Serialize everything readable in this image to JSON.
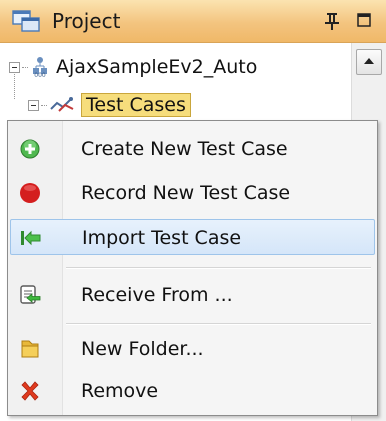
{
  "panel": {
    "title": "Project",
    "icons": {
      "project": "project-tree-icon",
      "pin": "pin-icon",
      "maximize": "maximize-icon"
    }
  },
  "tree": {
    "root_label": "AjaxSampleEv2_Auto",
    "child_label": "Test Cases",
    "icons": {
      "root": "project-node-icon",
      "child": "test-cases-icon"
    }
  },
  "context_menu": {
    "items": [
      {
        "label": "Create New Test Case",
        "icon": "green-plus-icon"
      },
      {
        "label": "Record New Test Case",
        "icon": "red-record-icon"
      },
      {
        "label": "Import Test Case",
        "icon": "import-arrow-icon",
        "highlighted": true
      },
      {
        "label": "Receive From ...",
        "icon": "receive-icon"
      },
      {
        "label": "New Folder...",
        "icon": "folder-icon"
      },
      {
        "label": "Remove",
        "icon": "red-x-icon"
      }
    ]
  },
  "colors": {
    "header": "#f3c47f",
    "selection": "#f6dd7c",
    "menu_highlight": "#d5e6f9",
    "record_red": "#d41e1e",
    "add_green": "#3aa53a"
  }
}
